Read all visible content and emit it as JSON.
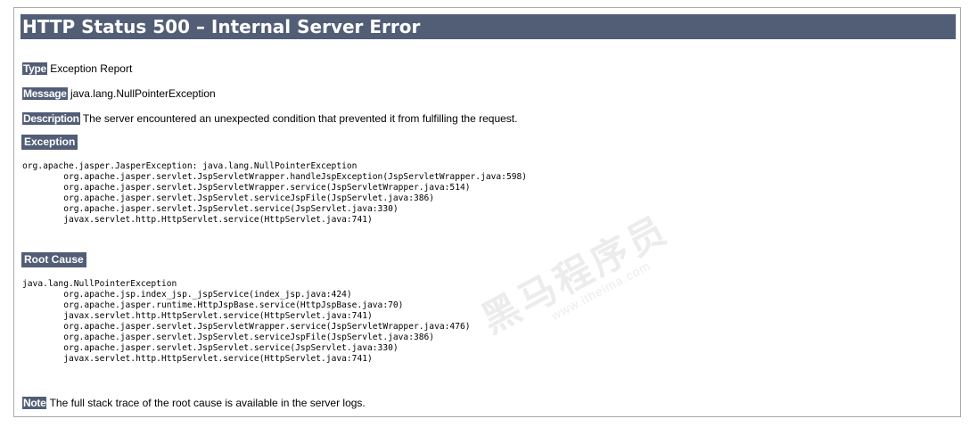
{
  "title": "HTTP Status 500 – Internal Server Error",
  "type": {
    "label": "Type",
    "value": " Exception Report"
  },
  "message": {
    "label": "Message",
    "value": " java.lang.NullPointerException"
  },
  "description": {
    "label": "Description",
    "value": " The server encountered an unexpected condition that prevented it from fulfilling the request."
  },
  "exception": {
    "heading": "Exception",
    "trace": "org.apache.jasper.JasperException: java.lang.NullPointerException\n\torg.apache.jasper.servlet.JspServletWrapper.handleJspException(JspServletWrapper.java:598)\n\torg.apache.jasper.servlet.JspServletWrapper.service(JspServletWrapper.java:514)\n\torg.apache.jasper.servlet.JspServlet.serviceJspFile(JspServlet.java:386)\n\torg.apache.jasper.servlet.JspServlet.service(JspServlet.java:330)\n\tjavax.servlet.http.HttpServlet.service(HttpServlet.java:741)"
  },
  "root_cause": {
    "heading": "Root Cause",
    "trace": "java.lang.NullPointerException\n\torg.apache.jsp.index_jsp._jspService(index_jsp.java:424)\n\torg.apache.jasper.runtime.HttpJspBase.service(HttpJspBase.java:70)\n\tjavax.servlet.http.HttpServlet.service(HttpServlet.java:741)\n\torg.apache.jasper.servlet.JspServletWrapper.service(JspServletWrapper.java:476)\n\torg.apache.jasper.servlet.JspServlet.serviceJspFile(JspServlet.java:386)\n\torg.apache.jasper.servlet.JspServlet.service(JspServlet.java:330)\n\tjavax.servlet.http.HttpServlet.service(HttpServlet.java:741)"
  },
  "note": {
    "label": "Note",
    "value": " The full stack trace of the root cause is available in the server logs."
  },
  "watermark": {
    "text": "黑马程序员",
    "url": "www.itheima.com"
  },
  "colors": {
    "header_bg": "#525d76",
    "header_fg": "#ffffff"
  }
}
